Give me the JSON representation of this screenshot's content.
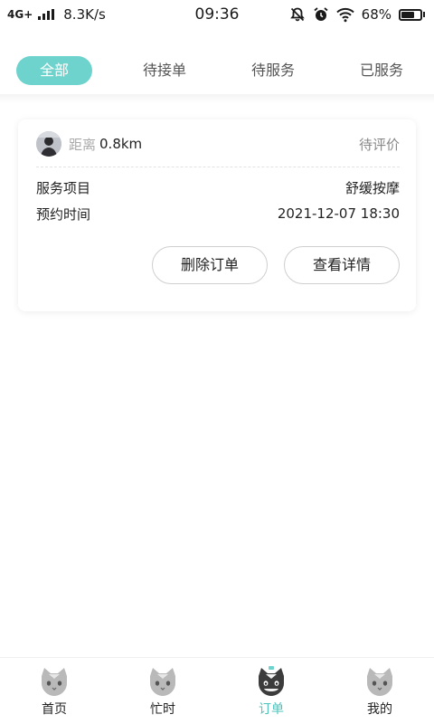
{
  "status_bar": {
    "network": "4G+",
    "speed": "8.3K/s",
    "time": "09:36",
    "battery": "68%",
    "battery_level": 0.68,
    "icons": [
      "signal-icon",
      "mute-bell-icon",
      "alarm-icon",
      "wifi-icon",
      "battery-icon"
    ]
  },
  "tabs": [
    {
      "label": "全部",
      "active": true
    },
    {
      "label": "待接单",
      "active": false
    },
    {
      "label": "待服务",
      "active": false
    },
    {
      "label": "已服务",
      "active": false
    }
  ],
  "order": {
    "distance_label": "距离",
    "distance_value": "0.8km",
    "status": "待评价",
    "service_label": "服务项目",
    "service_value": "舒缓按摩",
    "time_label": "预约时间",
    "time_value": "2021-12-07 18:30",
    "delete_label": "删除订单",
    "detail_label": "查看详情"
  },
  "nav": [
    {
      "label": "首页",
      "icon": "cat-home-icon",
      "active": false
    },
    {
      "label": "忙时",
      "icon": "cat-busy-icon",
      "active": false
    },
    {
      "label": "订单",
      "icon": "cat-order-icon",
      "active": true
    },
    {
      "label": "我的",
      "icon": "cat-profile-icon",
      "active": false
    }
  ],
  "colors": {
    "accent": "#6fd3cd",
    "accent_text": "#4ec2bb"
  }
}
